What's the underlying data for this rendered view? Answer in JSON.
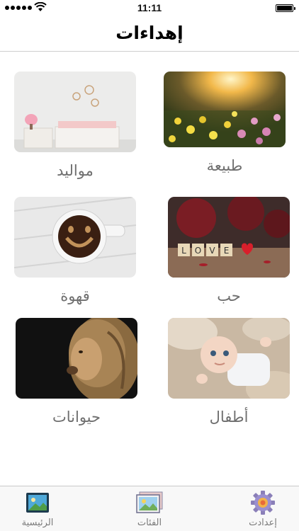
{
  "status_bar": {
    "time": "11:11"
  },
  "nav": {
    "title": "إهداءات"
  },
  "categories": [
    {
      "label": "طبيعة"
    },
    {
      "label": "مواليد"
    },
    {
      "label": "حب"
    },
    {
      "label": "قهوة"
    },
    {
      "label": "أطفال"
    },
    {
      "label": "حيوانات"
    }
  ],
  "tab_bar": {
    "items": [
      {
        "label": "إعدادت",
        "icon": "gear-icon"
      },
      {
        "label": "الفئات",
        "icon": "gallery-icon"
      },
      {
        "label": "الرئيسية",
        "icon": "landscape-photo-icon"
      }
    ]
  }
}
